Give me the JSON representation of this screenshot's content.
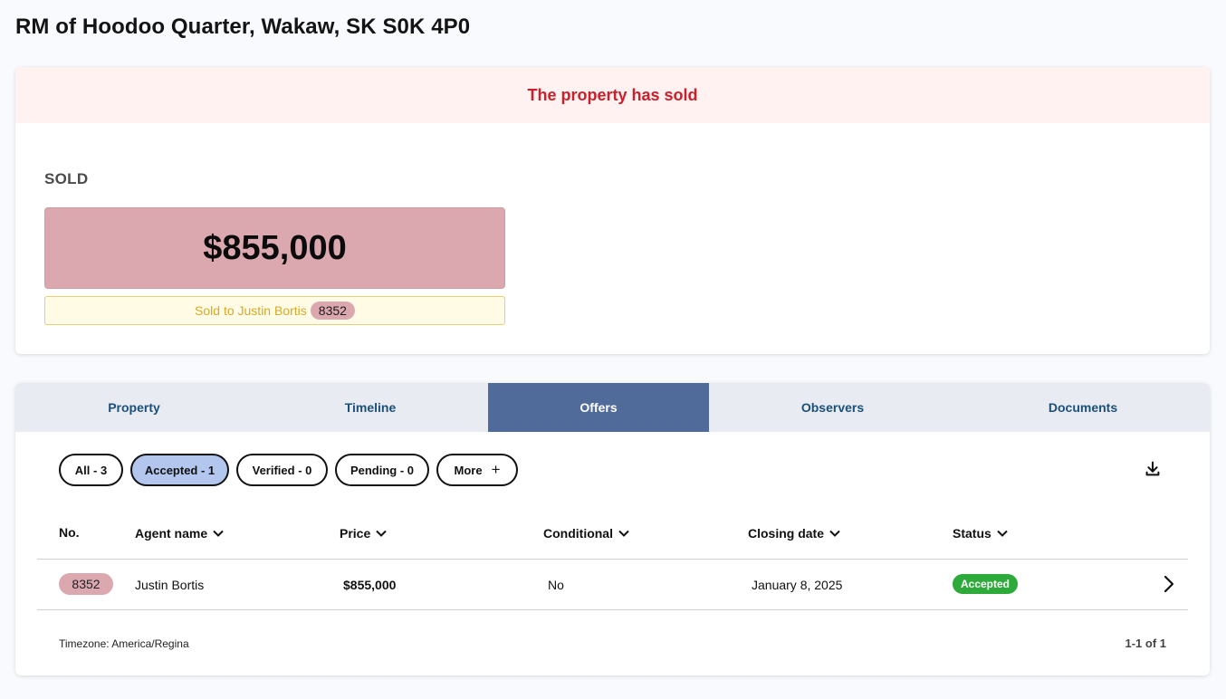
{
  "page": {
    "title": "RM of Hoodoo Quarter, Wakaw, SK S0K 4P0"
  },
  "summary": {
    "banner": "The property has sold",
    "status_label": "SOLD",
    "price": "$855,000",
    "sold_to_text": "Sold to Justin Bortis",
    "sold_to_number": "8352"
  },
  "tabs": [
    {
      "label": "Property"
    },
    {
      "label": "Timeline"
    },
    {
      "label": "Offers",
      "active": true
    },
    {
      "label": "Observers"
    },
    {
      "label": "Documents"
    }
  ],
  "filters": [
    {
      "label": "All - 3"
    },
    {
      "label": "Accepted - 1",
      "active": true
    },
    {
      "label": "Verified - 0"
    },
    {
      "label": "Pending - 0"
    },
    {
      "label": "More"
    }
  ],
  "table": {
    "columns": [
      "No.",
      "Agent name",
      "Price",
      "Conditional",
      "Closing date",
      "Status"
    ],
    "rows": [
      {
        "number": "8352",
        "agent": "Justin Bortis",
        "price": "$855,000",
        "conditional": "No",
        "closing_date": "January 8, 2025",
        "status": "Accepted"
      }
    ]
  },
  "footer": {
    "timezone": "Timezone: America/Regina",
    "pagination": "1-1 of 1"
  },
  "icons": {
    "download": "download-icon",
    "chevron": "chevron-down-icon",
    "row_arrow": "chevron-right-icon",
    "plus": "plus-icon"
  },
  "colors": {
    "banner_text": "#cc1f2c",
    "price_box": "#dba8b0",
    "active_tab": "#506b9a",
    "active_filter": "#b3c6ee",
    "status_accepted": "#2eaa3a"
  }
}
